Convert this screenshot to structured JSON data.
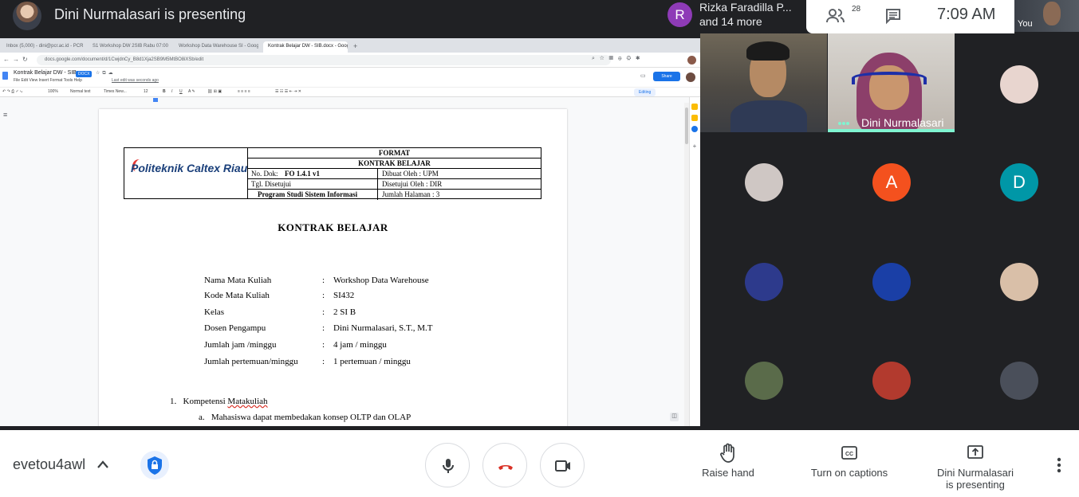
{
  "top_bar": {
    "presenting_title": "Dini Nurmalasari is presenting",
    "notification": {
      "avatar_letter": "R",
      "line1": "Rizka Faradilla P...",
      "line2": "and 14 more",
      "avatar_color": "#8e3bb7"
    },
    "participant_count": "28",
    "time": "7:09 AM",
    "self_label": "You"
  },
  "browser": {
    "tabs": [
      "Inbox (5,000) - dini@pcr.ac.id - PCR",
      "S1 Workshop DW 2SIB Rabu 07:00",
      "Workshop Data Warehouse SI - Google",
      "Kontrak Belajar DW - SIB.docx - Google"
    ],
    "url": "docs.google.com/document/d/1CwjdnCy_B8d1Xja2SB9M5MtBO8iXSb/edit"
  },
  "docs": {
    "title": "Kontrak Belajar DW - SIB",
    "badge": "DOCX",
    "menu": "File   Edit   View   Insert   Format   Tools   Help",
    "last_edit": "Last edit was seconds ago",
    "share_label": "Share",
    "toolbar": {
      "zoom": "100%",
      "style": "Normal text",
      "font": "Times New...",
      "font_size": "12",
      "mode": "Editing"
    },
    "doc_header": {
      "logo_text": "Politeknik Caltex Riau",
      "format": "FORMAT",
      "doc_type": "KONTRAK BELAJAR",
      "no_dok_label": "No. Dok:",
      "no_dok_value": "FO 1.4.1 v1",
      "dibuat_oleh": "Dibuat Oleh : UPM",
      "tgl_disetujui": "Tgl. Disetujui",
      "disetujui_oleh": "Disetujui Oleh :  DIR",
      "program_studi": "Program Studi Sistem Informasi",
      "jumlah_halaman": "Jumlah Halaman : 3"
    },
    "heading": "KONTRAK BELAJAR",
    "info_rows": [
      {
        "label": "Nama Mata Kuliah",
        "value": "Workshop Data Warehouse"
      },
      {
        "label": "Kode Mata Kuliah",
        "value": "SI432"
      },
      {
        "label": "Kelas",
        "value": "2 SI B"
      },
      {
        "label": "Dosen Pengampu",
        "value": "Dini Nurmalasari, S.T., M.T"
      },
      {
        "label": "Jumlah jam /minggu",
        "value": "4 jam / minggu"
      },
      {
        "label": "Jumlah pertemuan/minggu",
        "value": "1 pertemuan / minggu"
      }
    ],
    "colon": ":",
    "list_item_number": "1.",
    "list_item_pre": "Kompetensi ",
    "list_item_underlined": "Matakuliah",
    "sub_item_letter": "a.",
    "sub_item_text": "Mahasiswa dapat membedakan konsep OLTP dan OLAP"
  },
  "participants": {
    "active_speaker_name": "Dini Nurmalasari",
    "avatars": [
      {
        "letter": "",
        "color": "#e8d5cf"
      },
      {
        "letter": "",
        "color": "#cfc7c4"
      },
      {
        "letter": "A",
        "color": "#f4511e"
      },
      {
        "letter": "D",
        "color": "#0097a7"
      },
      {
        "letter": "",
        "color": "#2d3a8c"
      },
      {
        "letter": "",
        "color": "#1a3fa6"
      },
      {
        "letter": "",
        "color": "#d9bfa8"
      },
      {
        "letter": "",
        "color": "#5a6b4a"
      },
      {
        "letter": "",
        "color": "#b23a2e"
      },
      {
        "letter": "",
        "color": "#4a4f5a"
      }
    ]
  },
  "bottom_bar": {
    "meeting_code": "evetou4awl",
    "raise_hand": "Raise hand",
    "captions": "Turn on captions",
    "presenting_line1": "Dini Nurmalasari",
    "presenting_line2": "is presenting",
    "end_call_color": "#d93025"
  }
}
